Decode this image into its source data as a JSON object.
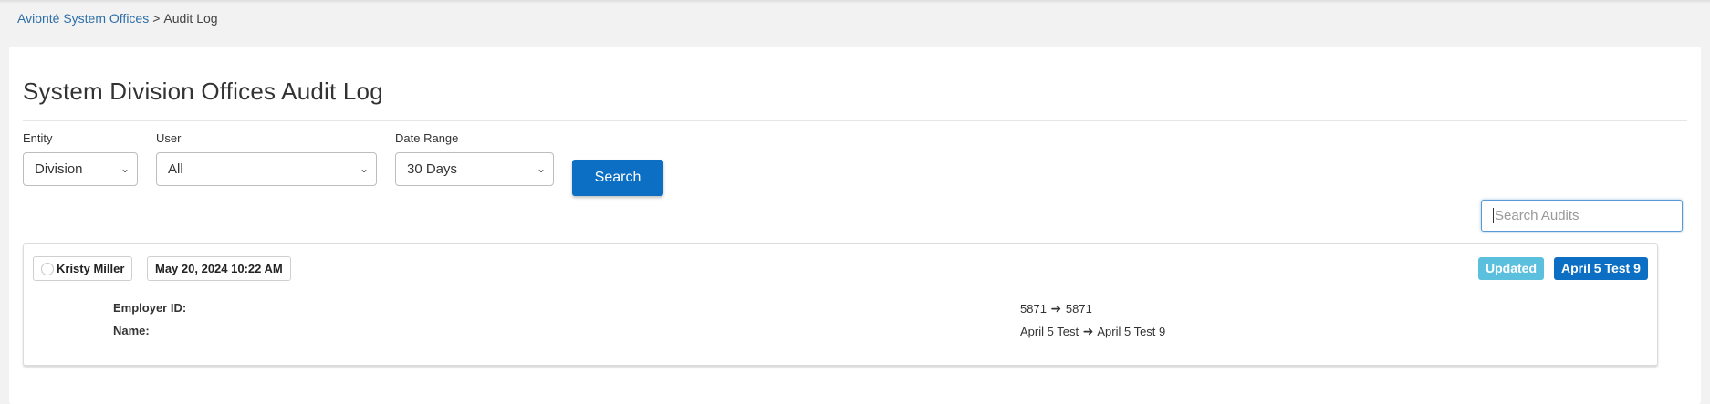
{
  "breadcrumb": {
    "parent": "Avionté System Offices",
    "separator": ">",
    "current": "Audit Log"
  },
  "page": {
    "title": "System Division Offices Audit Log"
  },
  "filters": {
    "entity": {
      "label": "Entity",
      "value": "Division"
    },
    "user": {
      "label": "User",
      "value": "All"
    },
    "date_range": {
      "label": "Date Range",
      "value": "30 Days"
    },
    "search_label": "Search"
  },
  "search_audits": {
    "placeholder": "Search Audits"
  },
  "audit": {
    "user": "Kristy Miller",
    "timestamp": "May 20, 2024 10:22 AM",
    "action_badge": "Updated",
    "entity_badge": "April 5 Test 9",
    "arrow": "➜",
    "changes": [
      {
        "field": "Employer ID:",
        "old": "5871",
        "new": "5871"
      },
      {
        "field": "Name:",
        "old": "April 5 Test",
        "new": "April 5 Test 9"
      }
    ]
  },
  "colors": {
    "primary": "#0d6fc4",
    "updated_badge": "#5bc0de",
    "link": "#2f6fa8"
  },
  "icons": {
    "user_avatar": "avatar-circle-icon",
    "select_chevron": "chevron-down-icon",
    "change_arrow": "arrow-right-icon"
  }
}
